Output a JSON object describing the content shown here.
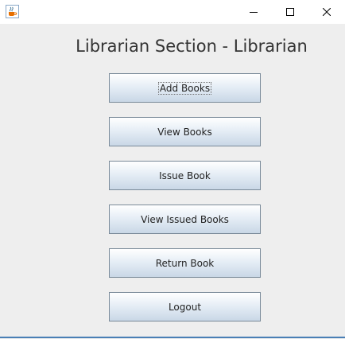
{
  "window": {
    "title_icon": "java-coffee-cup-icon",
    "controls": {
      "minimize": "minimize-icon",
      "maximize": "maximize-icon",
      "close": "close-icon"
    }
  },
  "main": {
    "heading": "Librarian Section - Librarian",
    "buttons": [
      {
        "label": "Add Books"
      },
      {
        "label": "View Books"
      },
      {
        "label": "Issue Book"
      },
      {
        "label": "View Issued Books"
      },
      {
        "label": "Return Book"
      },
      {
        "label": "Logout"
      }
    ],
    "focused_button": "Add Books"
  },
  "colors": {
    "window_bg": "#eeeeee",
    "titlebar_bg": "#ffffff",
    "button_border": "#7a8a99",
    "accent_line": "#4a7fb5"
  }
}
